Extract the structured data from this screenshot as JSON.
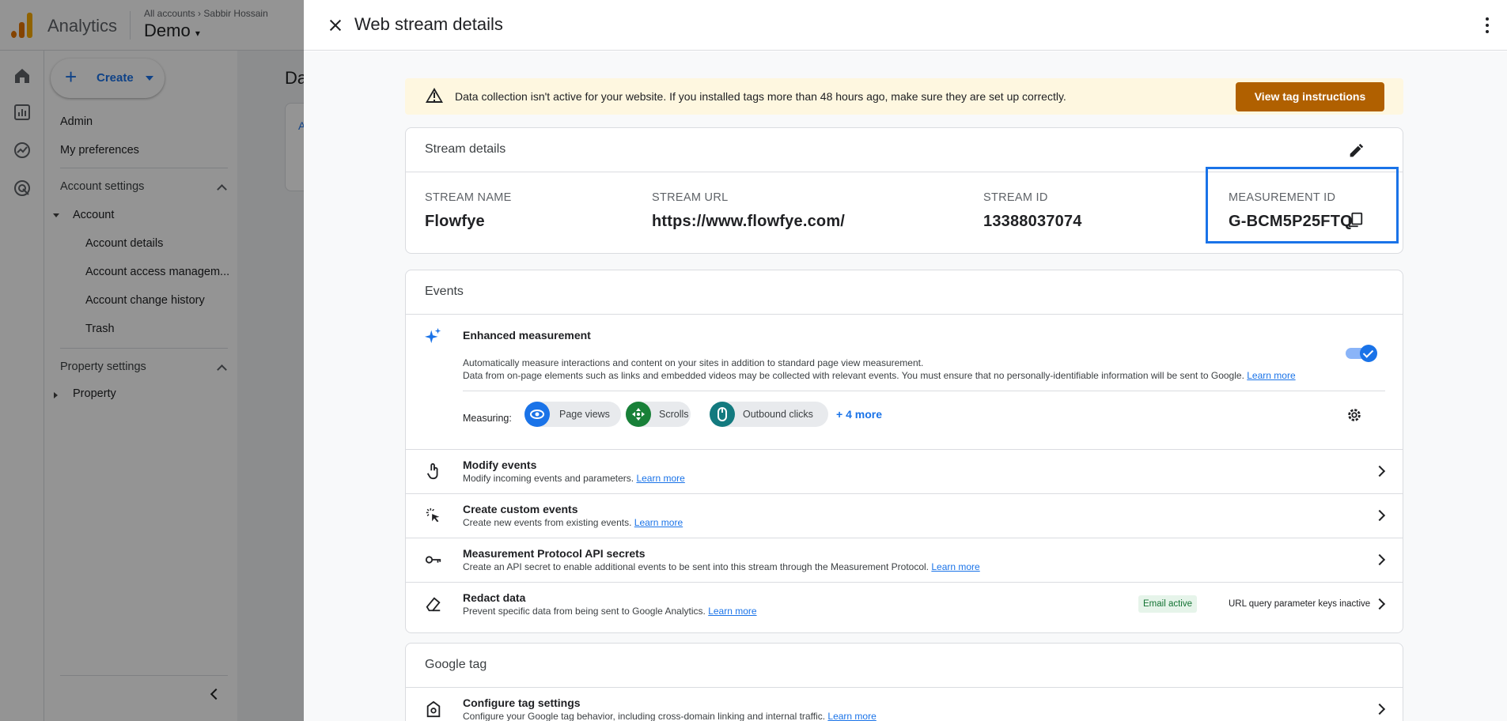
{
  "app": {
    "name": "Analytics",
    "breadcrumb_all": "All accounts",
    "breadcrumb_account": "Sabbir Hossain",
    "property": "Demo"
  },
  "sidebar": {
    "create_label": "Create",
    "admin": "Admin",
    "my_preferences": "My preferences",
    "account_settings": "Account settings",
    "account": "Account",
    "account_items": [
      "Account details",
      "Account access managem...",
      "Account change history",
      "Trash"
    ],
    "property_settings": "Property settings",
    "property": "Property"
  },
  "background_page": {
    "title_fragment": "Da",
    "tab_fragment": "A"
  },
  "drawer": {
    "title": "Web stream details",
    "alert": {
      "text": "Data collection isn't active for your website. If you installed tags more than 48 hours ago, make sure they are set up correctly.",
      "button": "View tag instructions"
    },
    "stream_details": {
      "title": "Stream details",
      "fields": [
        {
          "label": "STREAM NAME",
          "value": "Flowfye"
        },
        {
          "label": "STREAM URL",
          "value": "https://www.flowfye.com/"
        },
        {
          "label": "STREAM ID",
          "value": "13388037074"
        },
        {
          "label": "MEASUREMENT ID",
          "value": "G-BCM5P25FTQ"
        }
      ]
    },
    "events": {
      "title": "Events",
      "enhanced": {
        "title": "Enhanced measurement",
        "desc1": "Automatically measure interactions and content on your sites in addition to standard page view measurement.",
        "desc2": "Data from on-page elements such as links and embedded videos may be collected with relevant events. You must ensure that no personally-identifiable information will be sent to Google.",
        "learn_more": "Learn more",
        "enabled": true,
        "measuring_label": "Measuring:",
        "chips": [
          "Page views",
          "Scrolls",
          "Outbound clicks"
        ],
        "more": "+ 4 more"
      },
      "rows": [
        {
          "title": "Modify events",
          "desc": "Modify incoming events and parameters.",
          "link": "Learn more"
        },
        {
          "title": "Create custom events",
          "desc": "Create new events from existing events.",
          "link": "Learn more"
        },
        {
          "title": "Measurement Protocol API secrets",
          "desc": "Create an API secret to enable additional events to be sent into this stream through the Measurement Protocol.",
          "link": "Learn more"
        },
        {
          "title": "Redact data",
          "desc": "Prevent specific data from being sent to Google Analytics.",
          "link": "Learn more",
          "badge_active": "Email active",
          "badge_inactive": "URL query parameter keys inactive"
        }
      ]
    },
    "google_tag": {
      "title": "Google tag",
      "row": {
        "title": "Configure tag settings",
        "desc": "Configure your Google tag behavior, including cross-domain linking and internal traffic.",
        "link": "Learn more"
      }
    }
  },
  "colors": {
    "accent": "#1a73e8",
    "warning_bg": "#fef7e0",
    "warning_button": "#b06000",
    "chip_green": "#188038"
  }
}
